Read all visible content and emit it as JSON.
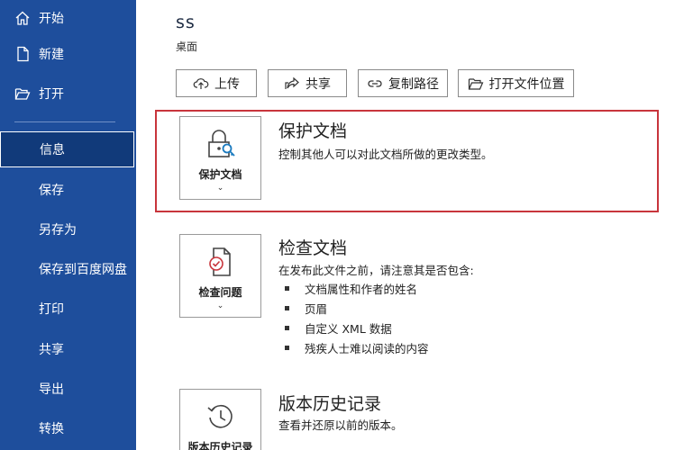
{
  "sidebar": {
    "items": [
      {
        "label": "开始",
        "icon": "home-icon"
      },
      {
        "label": "新建",
        "icon": "new-document-icon"
      },
      {
        "label": "打开",
        "icon": "folder-open-icon"
      },
      {
        "label": "信息"
      },
      {
        "label": "保存"
      },
      {
        "label": "另存为"
      },
      {
        "label": "保存到百度网盘"
      },
      {
        "label": "打印"
      },
      {
        "label": "共享"
      },
      {
        "label": "导出"
      },
      {
        "label": "转换"
      }
    ],
    "active_item": "信息"
  },
  "document": {
    "title": "ss",
    "location": "桌面"
  },
  "toolbar": {
    "upload_label": "上传",
    "share_label": "共享",
    "copy_path_label": "复制路径",
    "open_location_label": "打开文件位置"
  },
  "protect": {
    "button_label": "保护文档",
    "heading": "保护文档",
    "description": "控制其他人可以对此文档所做的更改类型。"
  },
  "inspect": {
    "button_label": "检查问题",
    "heading": "检查文档",
    "description": "在发布此文件之前，请注意其是否包含:",
    "bullets": [
      "文档属性和作者的姓名",
      "页眉",
      "自定义 XML 数据",
      "残疾人士难以阅读的内容"
    ]
  },
  "version": {
    "button_label": "版本历史记录",
    "heading": "版本历史记录",
    "description": "查看并还原以前的版本。"
  },
  "colors": {
    "sidebar_bg": "#1e4e9c",
    "sidebar_active_bg": "#113a7a",
    "highlight_border": "#c8353c"
  }
}
